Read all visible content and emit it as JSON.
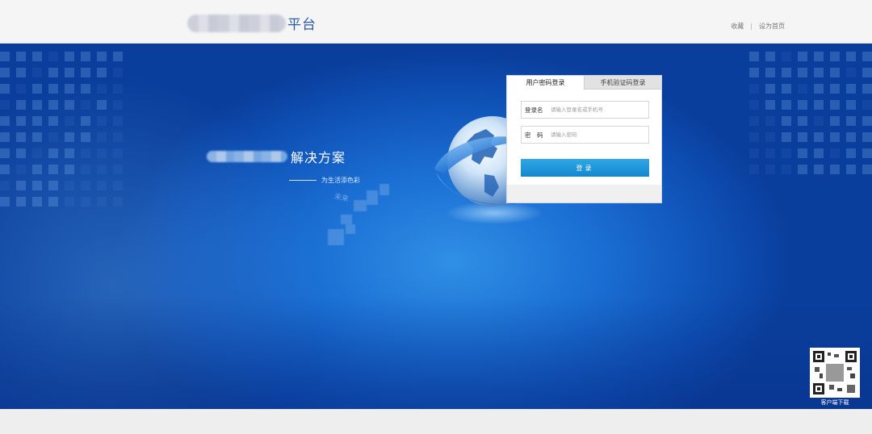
{
  "header": {
    "brand_suffix": "平台",
    "links": [
      "收藏",
      "设为首页"
    ],
    "separator": "|"
  },
  "hero": {
    "slogan_title": "解决方案",
    "slogan_subtitle": "为生活添色彩",
    "future_text": "未来"
  },
  "login": {
    "tabs": [
      "用户密码登录",
      "手机验证码登录"
    ],
    "username_label": "登录名",
    "username_placeholder": "请输入登录名或手机号",
    "password_label": "密　码",
    "password_placeholder": "请输入密码",
    "submit_label": "登录"
  },
  "qr": {
    "label": "客户端下载"
  },
  "colors": {
    "accent": "#1287cf",
    "hero_blue": "#1a6dd2",
    "brand_text": "#2a5aa8"
  }
}
